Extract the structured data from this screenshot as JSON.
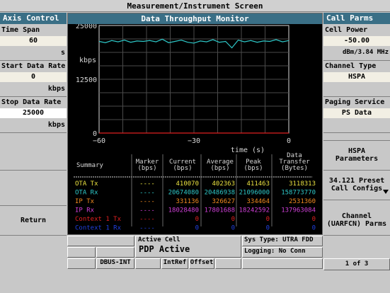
{
  "window": {
    "title": "Measurement/Instrument Screen"
  },
  "left_panel": {
    "header": "Axis Control",
    "time_span": {
      "label": "Time Span",
      "value": "60",
      "unit": "s"
    },
    "start_rate": {
      "label": "Start Data Rate",
      "value": "0",
      "unit": "kbps"
    },
    "stop_rate": {
      "label": "Stop Data Rate",
      "value": "25000",
      "unit": "kbps"
    },
    "return_label": "Return"
  },
  "right_panel": {
    "header": "Call Parms",
    "cell_power": {
      "label": "Cell Power",
      "value": "-50.00",
      "unit": "dBm/3.84 MHz"
    },
    "channel_type": {
      "label": "Channel Type",
      "value": "HSPA"
    },
    "paging_service": {
      "label": "Paging Service",
      "value": "PS Data"
    },
    "hspa_params": "HSPA Parameters",
    "preset_line1": "34.121 Preset",
    "preset_line2": "Call Configs",
    "channel_line1": "Channel",
    "channel_line2": "(UARFCN) Parms",
    "page_indicator": "1 of 3"
  },
  "chart": {
    "title": "Data Throughput Monitor",
    "y_unit_label": "kbps",
    "x_axis_label": "time (s)",
    "y_ticks": [
      "25000",
      "12500",
      "0"
    ],
    "x_ticks": [
      "−60",
      "−30",
      "0"
    ]
  },
  "chart_data": {
    "type": "line",
    "title": "Data Throughput Monitor",
    "xlabel": "time (s)",
    "ylabel": "kbps",
    "xlim": [
      -60,
      0
    ],
    "ylim": [
      0,
      25000
    ],
    "series": [
      {
        "name": "OTA Rx",
        "color": "#2ec8c8",
        "x": [
          -60,
          -58,
          -56,
          -54,
          -52,
          -50,
          -48,
          -46,
          -44,
          -42,
          -40,
          -38,
          -36,
          -34,
          -32,
          -30,
          -28,
          -26,
          -24,
          -22,
          -20,
          -18,
          -16,
          -14,
          -12,
          -10,
          -8,
          -6,
          -4,
          -2,
          0
        ],
        "values": [
          21300,
          21000,
          21500,
          21200,
          21600,
          21100,
          21400,
          21300,
          21500,
          21200,
          21800,
          21000,
          21300,
          21600,
          21100,
          20900,
          21400,
          21200,
          21700,
          21100,
          21300,
          19800,
          21600,
          21200,
          21500,
          21100,
          21400,
          21300,
          21700,
          21200,
          21500
        ]
      },
      {
        "name": "Context 1 Tx",
        "color": "#e02020",
        "x": [
          -60,
          0
        ],
        "values": [
          0,
          0
        ]
      }
    ]
  },
  "summary_table": {
    "headers": {
      "summary": "Summary",
      "marker": [
        "Marker",
        "(bps)"
      ],
      "current": [
        "Current",
        "(bps)"
      ],
      "average": [
        "Average",
        "(bps)"
      ],
      "peak": [
        "Peak",
        "(bps)"
      ],
      "transfer": [
        "Data",
        "Transfer",
        "(Bytes)"
      ]
    },
    "rows": [
      {
        "name": "OTA Tx",
        "marker": "----",
        "current": "410070",
        "average": "402363",
        "peak": "411463",
        "transfer": "3118313",
        "color": "#e8e040"
      },
      {
        "name": "OTA Rx",
        "marker": "----",
        "current": "20674080",
        "average": "20486938",
        "peak": "21096000",
        "transfer": "158773770",
        "color": "#2ec8c8"
      },
      {
        "name": "IP Tx",
        "marker": "----",
        "current": "331136",
        "average": "326627",
        "peak": "334464",
        "transfer": "2531360",
        "color": "#f08a20"
      },
      {
        "name": "IP Rx",
        "marker": "----",
        "current": "18028480",
        "average": "17801688",
        "peak": "18242592",
        "transfer": "137963084",
        "color": "#d040d8"
      },
      {
        "name": "Context 1 Tx",
        "marker": "----",
        "current": "0",
        "average": "0",
        "peak": "0",
        "transfer": "0",
        "color": "#e02020"
      },
      {
        "name": "Context 1 Rx",
        "marker": "----",
        "current": "0",
        "average": "0",
        "peak": "0",
        "transfer": "0",
        "color": "#2040e0"
      }
    ]
  },
  "status_bar": {
    "active_cell_label": "Active Cell",
    "active_cell_value": "PDP Active",
    "sys_type": "Sys Type: UTRA FDD",
    "logging": "Logging: No Conn",
    "dbus": "DBUS-INT",
    "intref": "IntRef",
    "offset": "Offset"
  }
}
